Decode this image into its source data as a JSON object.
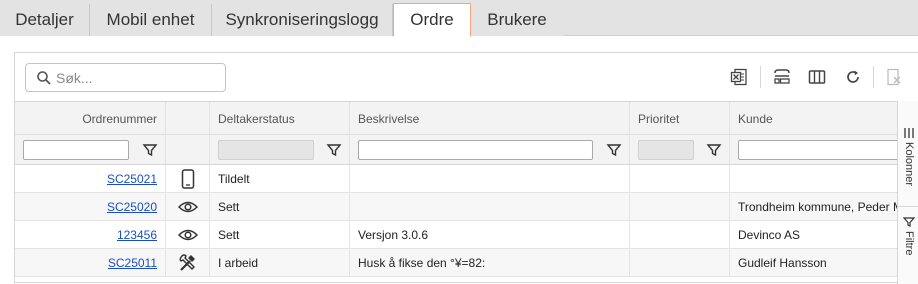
{
  "tabs": [
    {
      "label": "Detaljer",
      "active": false
    },
    {
      "label": "Mobil enhet",
      "active": false
    },
    {
      "label": "Synkroniseringslogg",
      "active": false
    },
    {
      "label": "Ordre",
      "active": true
    },
    {
      "label": "Brukere",
      "active": false
    }
  ],
  "search": {
    "placeholder": "Søk..."
  },
  "toolbar": {
    "icons": [
      "excel-export-icon",
      "group-rows-icon",
      "columns-icon",
      "refresh-icon",
      "clear-filter-icon"
    ]
  },
  "columns": [
    {
      "label": "Ordrenummer"
    },
    {
      "label": ""
    },
    {
      "label": "Deltakerstatus"
    },
    {
      "label": "Beskrivelse"
    },
    {
      "label": "Prioritet"
    },
    {
      "label": "Kunde"
    }
  ],
  "rows": [
    {
      "order": "SC25021",
      "status_icon": "mobile-phone-icon",
      "status": "Tildelt",
      "description": "",
      "priority": "",
      "customer": ""
    },
    {
      "order": "SC25020",
      "status_icon": "eye-icon",
      "status": "Sett",
      "description": "",
      "priority": "",
      "customer": "Trondheim kommune, Peder M"
    },
    {
      "order": "123456",
      "status_icon": "eye-icon",
      "status": "Sett",
      "description": "Versjon 3.0.6",
      "priority": "",
      "customer": "Devinco AS"
    },
    {
      "order": "SC25011",
      "status_icon": "tools-icon",
      "status": "I arbeid",
      "description": "Husk å fikse den °¥=82:",
      "priority": "",
      "customer": "Gudleif Hansson"
    }
  ],
  "side_panel": {
    "columns_label": "Kolonner",
    "filters_label": "Filtre"
  },
  "colors": {
    "active_tab_border": "#f0a878",
    "link": "#1a4fc4"
  }
}
